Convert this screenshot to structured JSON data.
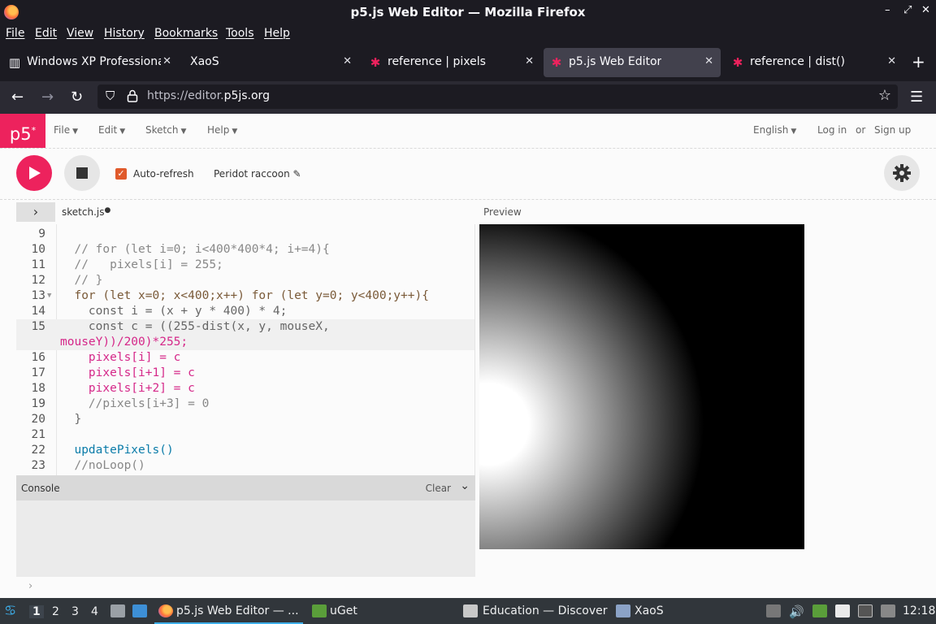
{
  "window": {
    "title": "p5.js Web Editor — Mozilla Firefox",
    "minimize": "–",
    "maximize": "⤢",
    "close": "✕"
  },
  "menubar": [
    "File",
    "Edit",
    "View",
    "History",
    "Bookmarks",
    "Tools",
    "Help"
  ],
  "tabs": [
    {
      "label": "Windows XP Professional",
      "icon": "document-icon",
      "close": "✕"
    },
    {
      "label": "XaoS",
      "icon": "",
      "close": "✕"
    },
    {
      "label": "reference | pixels",
      "icon": "p5-asterisk-icon",
      "close": "✕"
    },
    {
      "label": "p5.js Web Editor",
      "icon": "p5-asterisk-icon",
      "close": "✕"
    },
    {
      "label": "reference | dist()",
      "icon": "p5-asterisk-icon",
      "close": "✕"
    }
  ],
  "new_tab": "+",
  "nav": {
    "url_prefix": "https://editor.",
    "url_domain": "p5js.org"
  },
  "p5": {
    "logo": "p5",
    "logo_sup": "*",
    "menu": [
      "File",
      "Edit",
      "Sketch",
      "Help"
    ],
    "language": "English",
    "login": "Log in",
    "or": "or",
    "signup": "Sign up",
    "auto_refresh": "Auto-refresh",
    "auto_refresh_checked": true,
    "sketch_name": "Peridot raccoon",
    "file_tab": "sketch.js",
    "file_modified_dot": "●",
    "preview_label": "Preview",
    "console_label": "Console",
    "console_clear": "Clear",
    "console_prompt": "›"
  },
  "code_lines": [
    {
      "n": "9",
      "text": ""
    },
    {
      "n": "10",
      "text": "  // for (let i=0; i<400*400*4; i+=4){"
    },
    {
      "n": "11",
      "text": "  //   pixels[i] = 255;"
    },
    {
      "n": "12",
      "text": "  // }"
    },
    {
      "n": "13",
      "text": "  for (let x=0; x<400;x++) for (let y=0; y<400;y++){"
    },
    {
      "n": "14",
      "text": "    const i = (x + y * 400) * 4;"
    },
    {
      "n": "15",
      "text": "    const c = ((255-dist(x, y, mouseX,",
      "text2": "mouseY))/200)*255;"
    },
    {
      "n": "16",
      "text": "    pixels[i] = c"
    },
    {
      "n": "17",
      "text": "    pixels[i+1] = c"
    },
    {
      "n": "18",
      "text": "    pixels[i+2] = c"
    },
    {
      "n": "19",
      "text": "    //pixels[i+3] = 0"
    },
    {
      "n": "20",
      "text": "  }"
    },
    {
      "n": "21",
      "text": ""
    },
    {
      "n": "22",
      "text": "  updatePixels()"
    },
    {
      "n": "23",
      "text": "  //noLoop()"
    }
  ],
  "taskbar": {
    "desktops": [
      "1",
      "2",
      "3",
      "4"
    ],
    "apps": [
      {
        "label": "p5.js Web Editor — ...",
        "icon": "firefox-icon"
      },
      {
        "label": "uGet",
        "icon": "uget-icon"
      },
      {
        "label": "Education — Discover",
        "icon": "discover-icon"
      },
      {
        "label": "XaoS",
        "icon": "xaos-icon"
      }
    ],
    "clock": "12:18"
  },
  "colors": {
    "p5_pink": "#ed225d",
    "firefox_dark": "#1c1b22",
    "taskbar": "#31363b",
    "accent": "#3daee9"
  }
}
